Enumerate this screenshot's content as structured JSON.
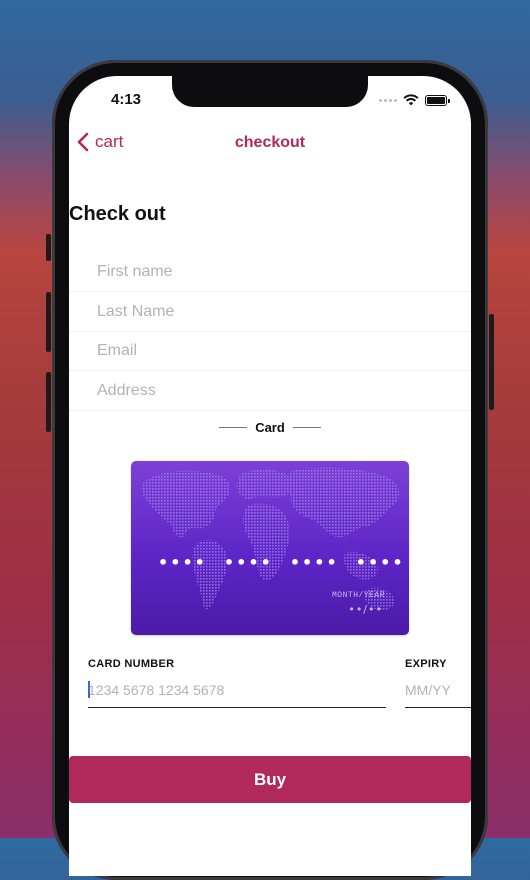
{
  "status_bar": {
    "time": "4:13"
  },
  "nav": {
    "back_label": "cart",
    "title": "checkout"
  },
  "form": {
    "heading": "Check out",
    "fields": [
      {
        "placeholder": "First name",
        "value": ""
      },
      {
        "placeholder": "Last Name",
        "value": ""
      },
      {
        "placeholder": "Email",
        "value": ""
      },
      {
        "placeholder": "Address",
        "value": ""
      }
    ]
  },
  "card_section": {
    "title": "Card",
    "card": {
      "number_groups": [
        "••••",
        "••••",
        "••••",
        "••••"
      ],
      "expiry_label": "MONTH/YEAR",
      "expiry_value": "••/••"
    },
    "card_number": {
      "label": "CARD NUMBER",
      "placeholder": "1234 5678 1234 5678",
      "value": ""
    },
    "expiry": {
      "label": "EXPIRY",
      "placeholder": "MM/YY",
      "value": ""
    }
  },
  "buy_button": {
    "label": "Buy"
  },
  "colors": {
    "accent": "#b1285a",
    "card_top": "#7d3fd6",
    "card_bottom": "#4d1aa8"
  }
}
